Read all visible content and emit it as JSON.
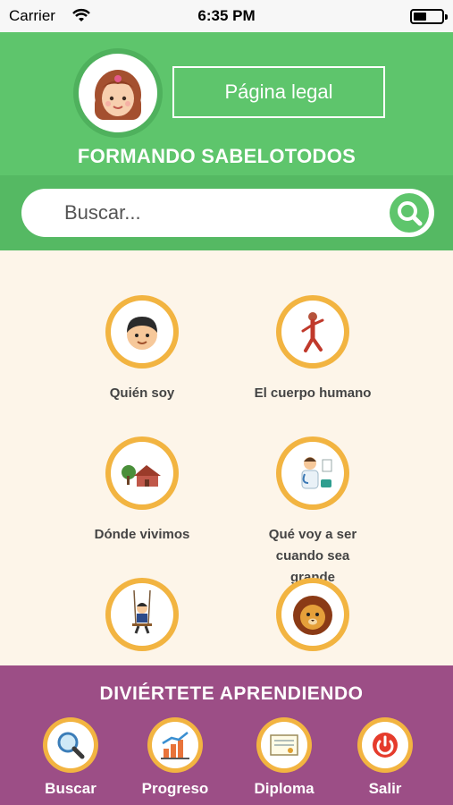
{
  "status_bar": {
    "carrier": "Carrier",
    "time": "6:35 PM"
  },
  "header": {
    "legal_button": "Página legal",
    "brand": "FORMANDO SABELOTODOS"
  },
  "search": {
    "placeholder": "Buscar..."
  },
  "topics": [
    {
      "label": "Quién soy",
      "icon": "boy-face-icon"
    },
    {
      "label": "El cuerpo humano",
      "icon": "human-body-icon"
    },
    {
      "label": "Dónde vivimos",
      "icon": "house-icon"
    },
    {
      "label": "Qué voy a ser cuando sea grande",
      "icon": "doctor-icon"
    },
    {
      "label": "",
      "icon": "swing-child-icon"
    },
    {
      "label": "",
      "icon": "lion-icon"
    }
  ],
  "bottom_bar": {
    "title": "DIVIÉRTETE APRENDIENDO",
    "items": [
      {
        "label": "Buscar",
        "icon": "magnifier-icon"
      },
      {
        "label": "Progreso",
        "icon": "progress-chart-icon"
      },
      {
        "label": "Diploma",
        "icon": "diploma-icon"
      },
      {
        "label": "Salir",
        "icon": "power-icon"
      }
    ]
  },
  "colors": {
    "green": "#5ec56c",
    "purple": "#9c4e86",
    "orange": "#f2b441",
    "cream": "#fdf5e9"
  }
}
